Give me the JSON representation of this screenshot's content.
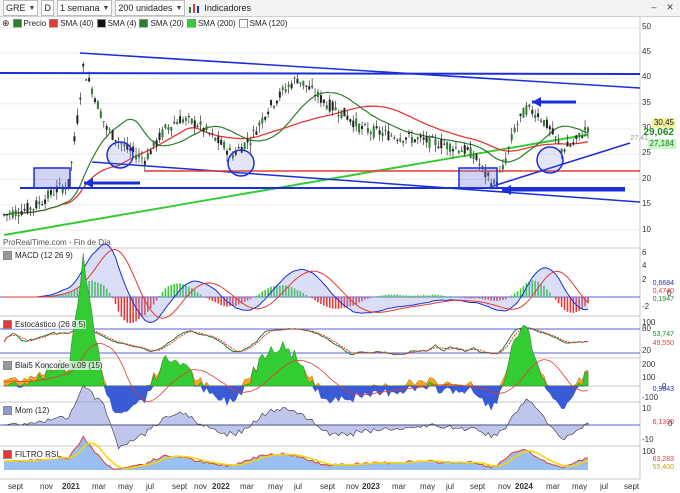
{
  "toolbar": {
    "symbol": "GRE",
    "mode_badge": "D",
    "period": "1 semana",
    "units": "200 unidades",
    "indicators_label": "Indicadores"
  },
  "main_legend": [
    {
      "label": "Precio",
      "color": "#2e7d32"
    },
    {
      "label": "SMA (40)",
      "color": "#e53935"
    },
    {
      "label": "SMA (4)",
      "color": "#111111"
    },
    {
      "label": "SMA (20)",
      "color": "#2e7d32"
    },
    {
      "label": "SMA (200)",
      "color": "#33cc33"
    },
    {
      "label": "SMA (120)",
      "color": "#ffffff"
    }
  ],
  "watermark": "ProRealTime.com - Fin de Día",
  "price_axis": [
    "50",
    "45",
    "40",
    "35",
    "30",
    "25",
    "20",
    "15",
    "10"
  ],
  "price_tags": {
    "last": "30,45",
    "sma_big": "29,062",
    "sma_a": "27,184",
    "sma_b": "27,41"
  },
  "panes": {
    "macd": {
      "label": "MACD (12 26 9)",
      "axis": [
        "6",
        "4",
        "2",
        "0",
        "-2"
      ],
      "values": [
        "0,6684",
        "0,4740",
        "0,1947"
      ]
    },
    "stoch": {
      "label": "Estocástico (26 8 5)",
      "axis": [
        "100",
        "80",
        "20"
      ],
      "values": [
        "53,747",
        "49,550"
      ]
    },
    "koncorde": {
      "label": "Blai5 Koncorde v.09 (15)",
      "axis": [
        "200",
        "100",
        "0",
        "-100"
      ],
      "values": [
        "0,9643"
      ]
    },
    "mom": {
      "label": "Mom (12)",
      "axis": [
        "10",
        "0",
        "-10"
      ],
      "values": [
        "6,1300"
      ]
    },
    "rsi": {
      "label": "FILTRO RSI",
      "axis": [
        "100"
      ],
      "values": [
        "63,283",
        "55,400"
      ]
    }
  },
  "x_axis": [
    {
      "label": "sept",
      "year": false
    },
    {
      "label": "nov",
      "year": false
    },
    {
      "label": "2021",
      "year": true
    },
    {
      "label": "mar",
      "year": false
    },
    {
      "label": "may",
      "year": false
    },
    {
      "label": "jul",
      "year": false
    },
    {
      "label": "sept",
      "year": false
    },
    {
      "label": "nov",
      "year": false
    },
    {
      "label": "2022",
      "year": true
    },
    {
      "label": "mar",
      "year": false
    },
    {
      "label": "may",
      "year": false
    },
    {
      "label": "jul",
      "year": false
    },
    {
      "label": "sept",
      "year": false
    },
    {
      "label": "nov",
      "year": false
    },
    {
      "label": "2023",
      "year": true
    },
    {
      "label": "mar",
      "year": false
    },
    {
      "label": "may",
      "year": false
    },
    {
      "label": "jul",
      "year": false
    },
    {
      "label": "sept",
      "year": false
    },
    {
      "label": "nov",
      "year": false
    },
    {
      "label": "2024",
      "year": true
    },
    {
      "label": "mar",
      "year": false
    },
    {
      "label": "may",
      "year": false
    },
    {
      "label": "jul",
      "year": false
    },
    {
      "label": "sept",
      "year": false
    }
  ],
  "colors": {
    "trendline": "#1a2fd6",
    "sma40": "#e53935",
    "sma20": "#2e7d32",
    "sma200": "#33cc33",
    "candle_up": "#2e7d32",
    "candle_down": "#222222"
  }
}
